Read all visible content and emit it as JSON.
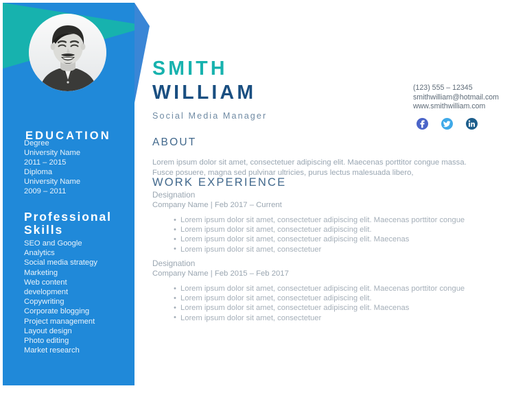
{
  "theme": {
    "sidebar_blue": "#2089d9",
    "accent_teal": "#17b2ae",
    "accent_mid_blue": "#3a86d6",
    "name_navy": "#1a4f81",
    "heading_steel": "#41688c",
    "body_gray": "#9aa6b1"
  },
  "sidebar": {
    "avatar_alt": "profile-photo",
    "education": {
      "heading": "EDUCATION",
      "entries": [
        {
          "degree": "Degree",
          "school": "University Name",
          "years": "2011 – 2015"
        },
        {
          "degree": "Diploma",
          "school": "University Name",
          "years": "2009 – 2011"
        }
      ]
    },
    "skills": {
      "heading": "Professional Skills",
      "items": [
        "SEO and Google",
        "Analytics",
        "Social media strategy",
        "Marketing",
        "Web content",
        "development",
        "Copywriting",
        "Corporate blogging",
        "Project management",
        "Layout design",
        "Photo editing",
        "Market research"
      ]
    }
  },
  "header": {
    "first_name": "SMITH",
    "last_name": "WILLIAM",
    "job_title": "Social Media Manager",
    "contact": {
      "phone": "(123) 555 – 12345",
      "email": "smithwilliam@hotmail.com",
      "website": "www.smithwilliam.com"
    },
    "socials": [
      {
        "name": "facebook",
        "label": "f",
        "color": "#4a64c8"
      },
      {
        "name": "twitter",
        "label": "t",
        "color": "#3fa9e8"
      },
      {
        "name": "linkedin",
        "label": "in",
        "color": "#1d5e8c"
      }
    ]
  },
  "about": {
    "heading": "ABOUT",
    "text": "Lorem ipsum dolor sit amet, consectetuer adipiscing elit. Maecenas porttitor congue massa. Fusce posuere, magna sed pulvinar ultricies, purus lectus malesuada libero,"
  },
  "work": {
    "heading": "WORK EXPERIENCE",
    "jobs": [
      {
        "designation": "Designation",
        "company": "Company Name | Feb 2017 – Current",
        "bullets": [
          "Lorem ipsum dolor sit amet, consectetuer adipiscing elit. Maecenas porttitor congue",
          "Lorem ipsum dolor sit amet, consectetuer adipiscing elit.",
          "Lorem ipsum dolor sit amet, consectetuer adipiscing elit. Maecenas",
          "Lorem ipsum dolor sit amet, consectetuer"
        ]
      },
      {
        "designation": "Designation",
        "company": "Company Name | Feb 2015 – Feb 2017",
        "bullets": [
          "Lorem ipsum dolor sit amet, consectetuer adipiscing elit. Maecenas porttitor congue",
          "Lorem ipsum dolor sit amet, consectetuer adipiscing elit.",
          "Lorem ipsum dolor sit amet, consectetuer adipiscing elit. Maecenas",
          "Lorem ipsum dolor sit amet, consectetuer"
        ]
      }
    ]
  }
}
